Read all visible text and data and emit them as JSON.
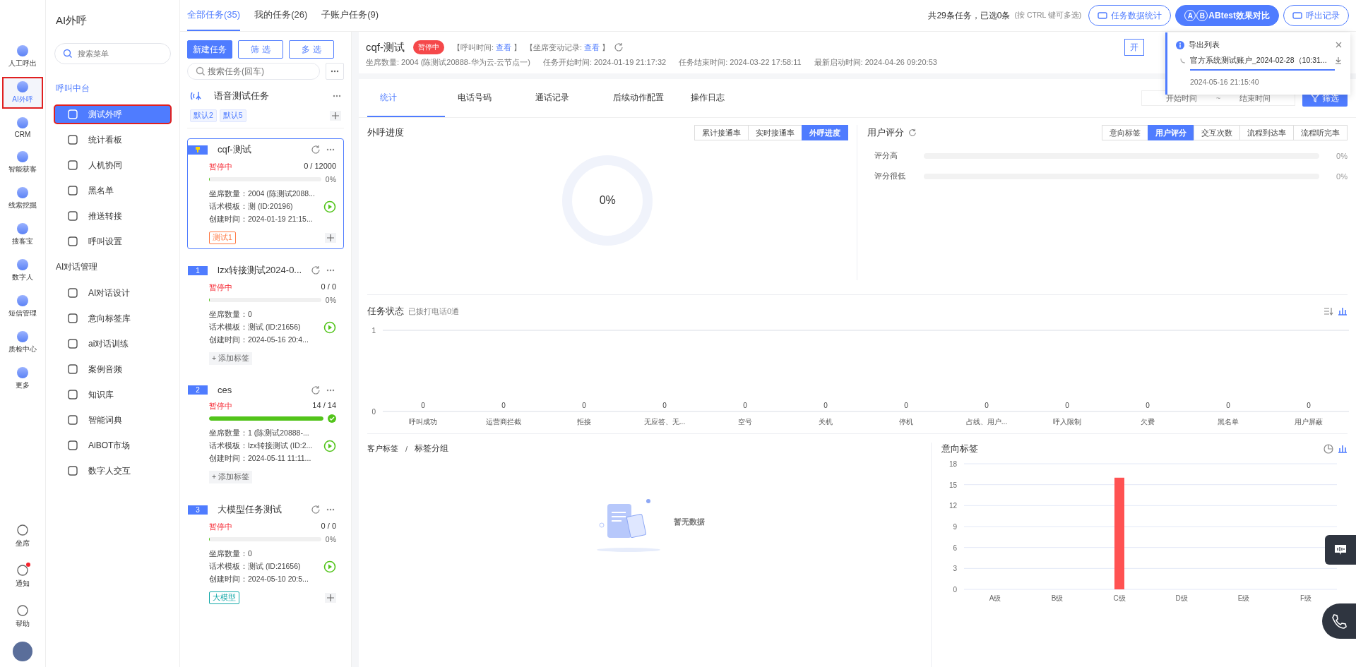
{
  "nav_rail": {
    "items": [
      {
        "label": "人工呼出",
        "selected": false
      },
      {
        "label": "AI外呼",
        "selected": true
      },
      {
        "label": "CRM",
        "selected": false
      },
      {
        "label": "智能获客",
        "selected": false
      },
      {
        "label": "线索挖掘",
        "selected": false
      },
      {
        "label": "搜客宝",
        "selected": false
      },
      {
        "label": "数字人",
        "selected": false
      },
      {
        "label": "短信管理",
        "selected": false
      },
      {
        "label": "质检中心",
        "selected": false
      },
      {
        "label": "更多",
        "selected": false
      }
    ],
    "bottom": [
      {
        "label": "坐席",
        "unread": false
      },
      {
        "label": "通知",
        "unread": true
      },
      {
        "label": "帮助",
        "unread": false
      }
    ]
  },
  "sidebar": {
    "title": "AI外呼",
    "search_placeholder": "搜索菜单",
    "groups": [
      {
        "title": "呼叫中台",
        "items": [
          {
            "label": "测试外呼",
            "selected": true
          },
          {
            "label": "统计看板",
            "selected": false
          },
          {
            "label": "人机协同",
            "selected": false
          },
          {
            "label": "黑名单",
            "selected": false
          },
          {
            "label": "推送转接",
            "selected": false
          },
          {
            "label": "呼叫设置",
            "selected": false
          }
        ]
      },
      {
        "title": "AI对话管理",
        "items": [
          {
            "label": "AI对话设计",
            "selected": false
          },
          {
            "label": "意向标签库",
            "selected": false
          },
          {
            "label": "ai对话训练",
            "selected": false
          },
          {
            "label": "案例音频",
            "selected": false
          },
          {
            "label": "知识库",
            "selected": false
          },
          {
            "label": "智能词典",
            "selected": false
          },
          {
            "label": "AiBOT市场",
            "selected": false
          },
          {
            "label": "数字人交互",
            "selected": false
          }
        ]
      }
    ]
  },
  "task_tabs": [
    {
      "label": "全部任务(35)",
      "selected": true
    },
    {
      "label": "我的任务(26)",
      "selected": false
    },
    {
      "label": "子账户任务(9)",
      "selected": false
    }
  ],
  "selection_info": "共29条任务，已选0条",
  "selection_hint": "(按 CTRL 键可多选)",
  "header_buttons": [
    {
      "label": "任务数据统计",
      "kind": "outline"
    },
    {
      "label": "ABtest效果对比",
      "kind": "primary",
      "badges": [
        "A",
        "B"
      ]
    },
    {
      "label": "呼出记录",
      "kind": "outline"
    }
  ],
  "task_list": {
    "buttons": [
      {
        "label": "新建任务",
        "kind": "primary"
      },
      {
        "label": "筛 选",
        "kind": "outline"
      },
      {
        "label": "多 选",
        "kind": "outline"
      }
    ],
    "search_placeholder": "搜索任务(回车)",
    "group": {
      "name": "语音测试任务",
      "tags": [
        "默认2",
        "默认5"
      ]
    },
    "tasks": [
      {
        "marker": {
          "kind": "pin"
        },
        "name": "cqf-测试",
        "status": "暂停中",
        "count": "0 / 12000",
        "level": 0,
        "percent": "0%",
        "complete": false,
        "seats": "坐席数量：2004 (陈测试2088...",
        "template": "话术模板：测 (ID:20196)",
        "created": "创建时间：2024-01-19 21:15...",
        "tags": [
          {
            "label": "测试1",
            "color": "#ff7a45"
          }
        ],
        "selected": true
      },
      {
        "marker": {
          "kind": "number",
          "text": "1"
        },
        "name": "lzx转接测试2024-0...",
        "status": "暂停中",
        "count": "0 / 0",
        "level": 0,
        "percent": "0%",
        "complete": false,
        "seats": "坐席数量：0",
        "template": "话术模板：测试 (ID:21656)",
        "created": "创建时间：2024-05-16 20:4...",
        "add_tag": "+ 添加标签",
        "selected": false
      },
      {
        "marker": {
          "kind": "number",
          "text": "2"
        },
        "name": "ces",
        "status": "暂停中",
        "count": "14 / 14",
        "level": 1,
        "complete": true,
        "seats": "坐席数量：1 (陈测试20888-...",
        "template": "话术模板：lzx转接测试 (ID:2...",
        "created": "创建时间：2024-05-11 11:11...",
        "add_tag": "+ 添加标签",
        "selected": false
      },
      {
        "marker": {
          "kind": "number",
          "text": "3"
        },
        "name": "大模型任务测试",
        "status": "暂停中",
        "count": "0 / 0",
        "level": 0,
        "percent": "0%",
        "complete": false,
        "seats": "坐席数量：0",
        "template": "话术模板：测试 (ID:21656)",
        "created": "创建时间：2024-05-10 20:5...",
        "tags": [
          {
            "label": "大模型",
            "color": "#13a8a8"
          }
        ],
        "selected": false
      }
    ]
  },
  "detail": {
    "title": "cqf-测试",
    "status": "暂停中",
    "links": [
      {
        "prefix": "【呼叫时间:",
        "link": "查看",
        "suffix": "】"
      },
      {
        "prefix": "【坐席变动记录:",
        "link": "查看",
        "suffix": "】"
      }
    ],
    "info": [
      "坐席数量:  2004 (陈测试20888-华为云-云节点一)",
      "任务开始时间:  2024-01-19 21:17:32",
      "任务结束时间:  2024-03-22 17:58:11",
      "最新启动时间:  2024-04-26 09:20:53"
    ],
    "partial_button": "开"
  },
  "detail_tabs": [
    {
      "label": "统计",
      "selected": true
    },
    {
      "label": "电话号码",
      "selected": false
    },
    {
      "label": "通话记录",
      "selected": false
    },
    {
      "label": "后续动作配置",
      "selected": false
    },
    {
      "label": "操作日志",
      "selected": false
    }
  ],
  "date_range": {
    "start_placeholder": "开始时间",
    "separator": "~",
    "end_placeholder": "结束时间"
  },
  "filter_button": "筛选",
  "progress_panel": {
    "title": "外呼进度",
    "segments": [
      {
        "label": "累计接通率",
        "selected": false
      },
      {
        "label": "实时接通率",
        "selected": false
      },
      {
        "label": "外呼进度",
        "selected": true
      }
    ],
    "level": 0,
    "value": "0%"
  },
  "rating_panel": {
    "title": "用户评分",
    "segments": [
      {
        "label": "意向标签",
        "selected": false
      },
      {
        "label": "用户评分",
        "selected": true
      },
      {
        "label": "交互次数",
        "selected": false
      },
      {
        "label": "流程到达率",
        "selected": false
      },
      {
        "label": "流程听完率",
        "selected": false
      }
    ],
    "rows": [
      {
        "label": "评分高",
        "level": 0,
        "value": "0%"
      },
      {
        "label": "评分很低",
        "level": 0,
        "value": "0%"
      }
    ]
  },
  "task_status": {
    "title": "任务状态",
    "subtitle": "已拨打电话0通",
    "chart_data": {
      "type": "bar",
      "categories": [
        "呼叫成功",
        "运营商拦截",
        "拒接",
        "无应答、无...",
        "空号",
        "关机",
        "停机",
        "占线、用户...",
        "呼入限制",
        "欠费",
        "黑名单",
        "用户屏蔽"
      ],
      "values": [
        0,
        0,
        0,
        0,
        0,
        0,
        0,
        0,
        0,
        0,
        0,
        0
      ],
      "ylim": [
        0,
        1
      ],
      "yticks": [
        0,
        1
      ],
      "data_labels": true
    }
  },
  "tag_panel": {
    "breadcrumb": [
      "客户标签",
      "标签分组"
    ],
    "breadcrumb_separator": "/",
    "empty_text": "暂无数据"
  },
  "intent_panel": {
    "title": "意向标签",
    "chart_data": {
      "type": "bar",
      "categories": [
        "A级",
        "B级",
        "C级",
        "D级",
        "E级",
        "F级"
      ],
      "values": [
        0,
        0,
        16,
        0,
        0,
        0
      ],
      "grid": true,
      "ylim": [
        0,
        18
      ],
      "yticks": [
        0,
        3,
        6,
        9,
        12,
        15,
        18
      ]
    }
  },
  "export_popup": {
    "title": "导出列表",
    "file": "官方系统测试账户_2024-02-28（10:31...",
    "level": 1,
    "time": "2024-05-16 21:15:40"
  }
}
